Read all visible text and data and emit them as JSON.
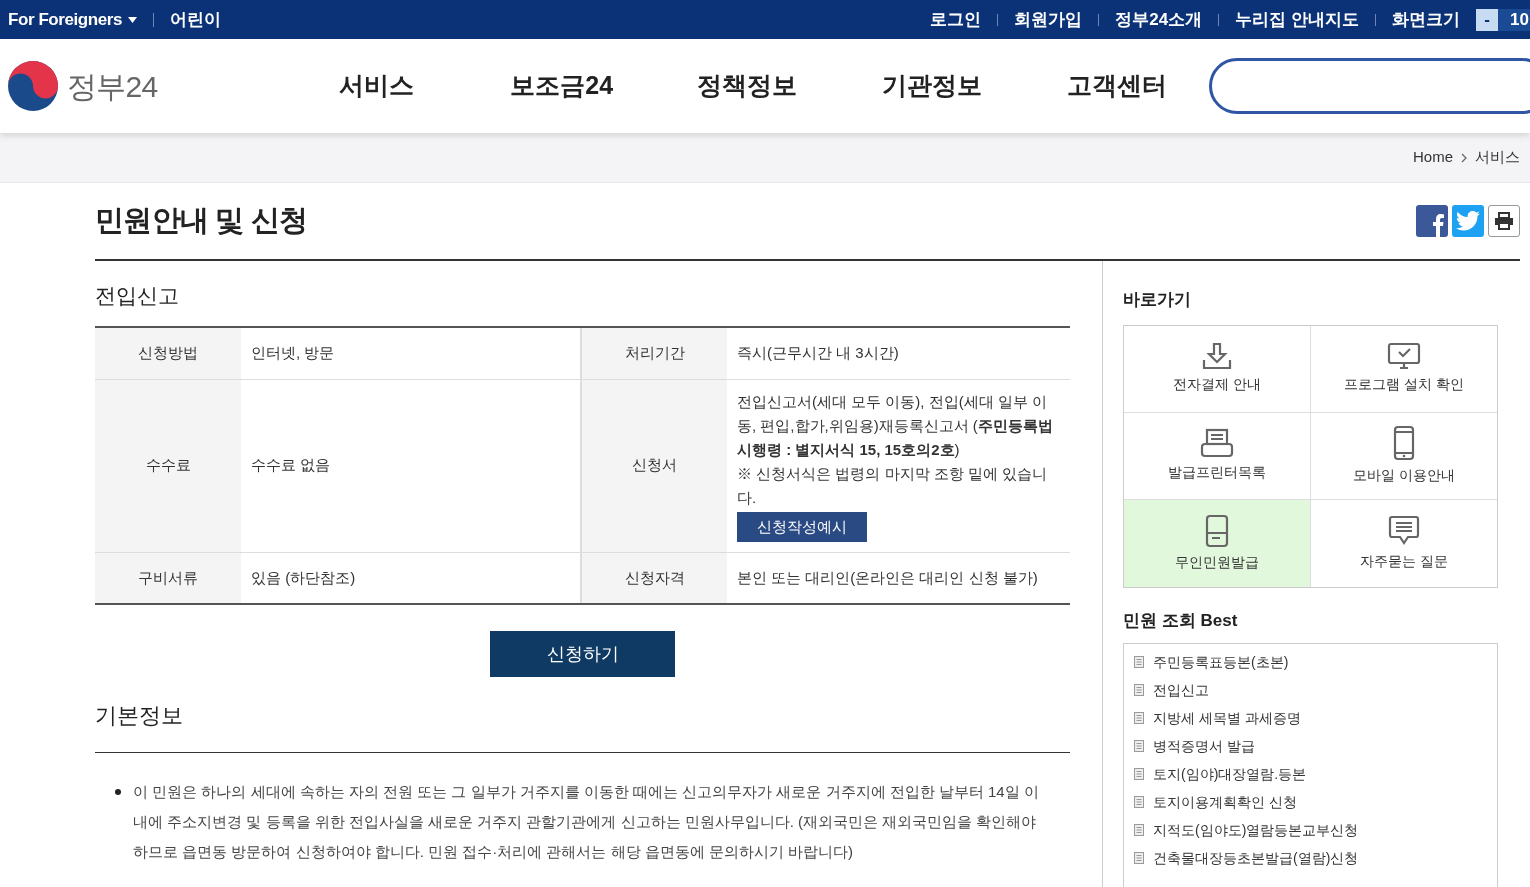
{
  "top_bar": {
    "language": "For Foreigners",
    "kids": "어린이",
    "links": [
      "로그인",
      "회원가입",
      "정부24소개",
      "누리집 안내지도"
    ],
    "screen_size": {
      "label": "화면크기",
      "minus": "-",
      "value": "10"
    }
  },
  "header": {
    "logo_text": "정부24",
    "nav": [
      "서비스",
      "보조금24",
      "정책정보",
      "기관정보",
      "고객센터"
    ]
  },
  "breadcrumb": [
    "Home",
    "서비스"
  ],
  "page_title": "민원안내 및 신청",
  "section_title": "전입신고",
  "info_rows": [
    {
      "label_1": "신청방법",
      "value_1": "인터넷, 방문",
      "label_2": "처리기간",
      "value_2": [
        "즉시(근무시간 내 3시간)"
      ]
    },
    {
      "label_1": "수수료",
      "value_1": "수수료 없음",
      "label_2": "신청서",
      "value_2": [
        "전입신고서(세대 모두 이동), 전입(세대 일부 이동, 편입,합가,위임용)재등록신고서 (**주민등록법 시행령 : 별지서식 15, 15호의2호**)",
        "※ 신청서식은 법령의 마지막 조항 밑에 있습니다."
      ],
      "button": "신청작성예시"
    },
    {
      "label_1": "구비서류",
      "value_1": "있음 (하단참조)",
      "label_2": "신청자격",
      "value_2": [
        "본인 또는 대리인(온라인은 대리인 신청 불가)"
      ]
    }
  ],
  "apply_button": "신청하기",
  "basic_info": {
    "title": "기본정보",
    "bullets": [
      "이 민원은 하나의 세대에 속하는 자의 전원 또는 그 일부가 거주지를 이동한 때에는 신고의무자가 새로운 거주지에 전입한 날부터 14일 이내에 주소지변경 및 등록을 위한 전입사실을 새로운 거주지 관할기관에게 신고하는 민원사무입니다. (재외국민은 재외국민임을 확인해야 하므로 읍면동 방문하여 신청하여야 합니다. 민원 접수·처리에 관해서는 해당 읍면동에 문의하시기 바랍니다)"
    ]
  },
  "quick_links": {
    "title": "바로가기",
    "items": [
      {
        "kind": "download",
        "label": "전자결제 안내",
        "highlighted": false
      },
      {
        "kind": "monitor",
        "label": "프로그램 설치 확인",
        "highlighted": false
      },
      {
        "kind": "printer",
        "label": "발급프린터목록",
        "highlighted": false
      },
      {
        "kind": "phone",
        "label": "모바일 이용안내",
        "highlighted": false
      },
      {
        "kind": "kiosk",
        "label": "무인민원발급",
        "highlighted": true
      },
      {
        "kind": "chat",
        "label": "자주묻는 질문",
        "highlighted": false
      }
    ]
  },
  "best": {
    "title": "민원 조회 Best",
    "items": [
      "주민등록표등본(초본)",
      "전입신고",
      "지방세 세목별 과세증명",
      "병적증명서 발급",
      "토지(임야)대장열람.등본",
      "토지이용계획확인 신청",
      "지적도(임야도)열람등본교부신청",
      "건축물대장등초본발급(열람)신청"
    ]
  }
}
